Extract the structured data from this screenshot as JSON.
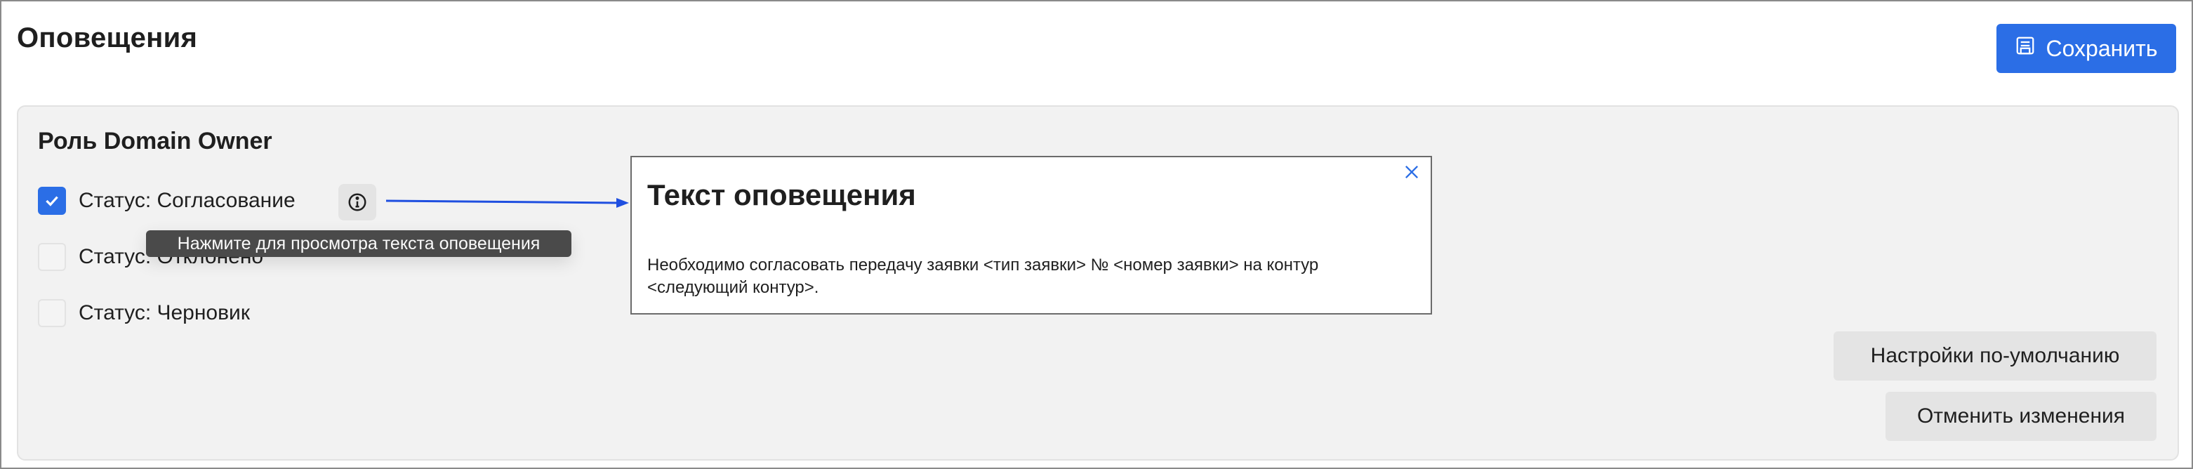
{
  "page": {
    "title": "Оповещения"
  },
  "toolbar": {
    "save_label": "Сохранить",
    "save_icon": "save-icon"
  },
  "role_section": {
    "title": "Роль Domain Owner",
    "statuses": [
      {
        "label": "Статус: Согласование",
        "checked": true
      },
      {
        "label": "Статус: Отклонено",
        "checked": false
      },
      {
        "label": "Статус: Черновик",
        "checked": false
      }
    ],
    "info_icon": "info-icon",
    "tooltip": "Нажмите для просмотра текста оповещения"
  },
  "notification_popup": {
    "title": "Текст оповещения",
    "body": "Необходимо согласовать передачу заявки <тип заявки> № <номер заявки> на контур <следующий контур>.",
    "close_icon": "close-icon"
  },
  "actions": {
    "defaults_label": "Настройки по-умолчанию",
    "cancel_label": "Отменить изменения"
  },
  "colors": {
    "accent": "#2b6ee6",
    "panel_bg": "#f2f2f2",
    "button_grey": "#e4e4e4",
    "tooltip_bg": "#4a4a4a"
  }
}
